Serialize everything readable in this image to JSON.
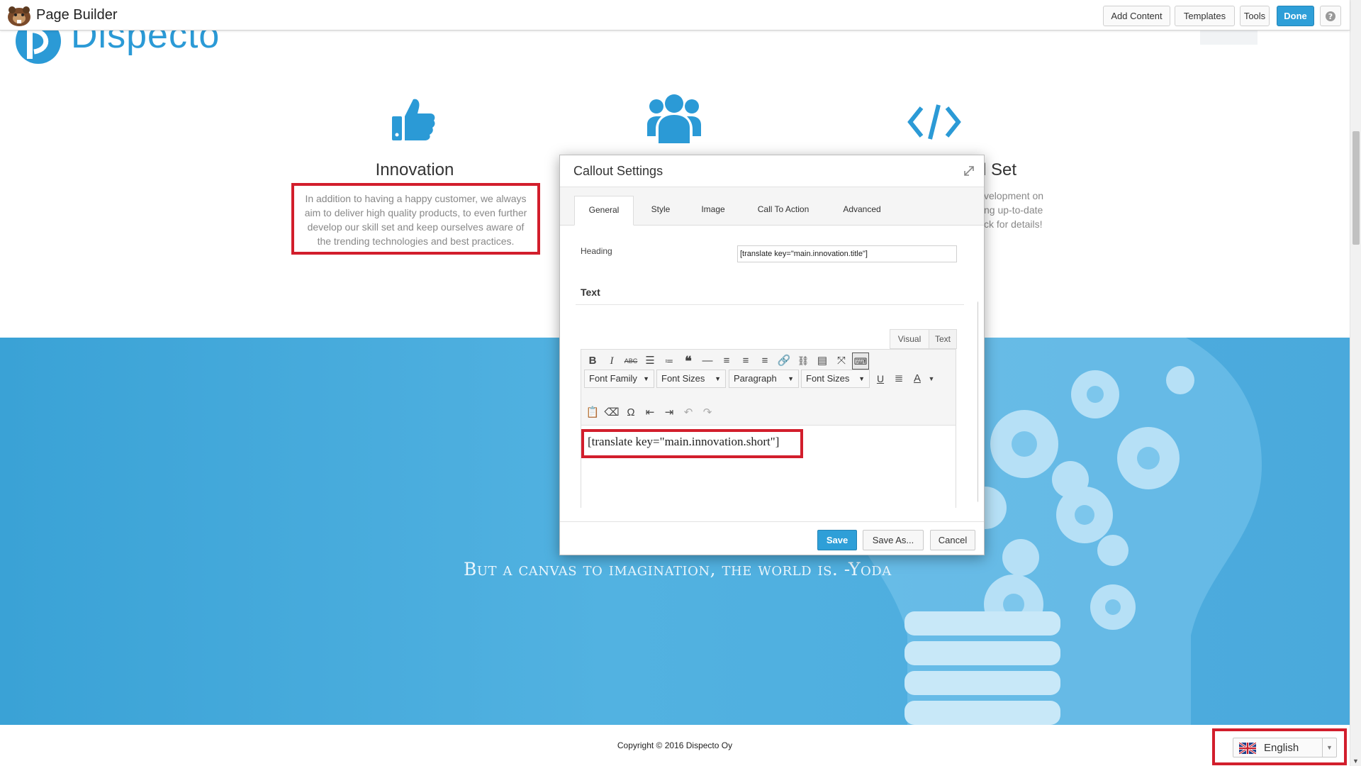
{
  "toolbar": {
    "title": "Page Builder",
    "add_content": "Add Content",
    "templates": "Templates",
    "tools": "Tools",
    "done": "Done",
    "help_icon": "question-icon"
  },
  "site": {
    "logo_text": "Dispecto",
    "features": [
      {
        "icon": "thumbs-up-icon",
        "title": "Innovation",
        "text": "In addition to having a happy customer, we always aim to deliver high quality products, to even further develop our skill set and keep ourselves aware of the trending technologies and best practices."
      },
      {
        "icon": "users-icon",
        "title": "",
        "text": ""
      },
      {
        "icon": "code-icon",
        "title": "l Set",
        "text_lines": [
          "velopment on",
          "ng up-to-date",
          "ck for details!"
        ]
      }
    ],
    "quote": "But a canvas to imagination, the world is. -Yoda",
    "copyright": "Copyright © 2016 Dispecto Oy",
    "language": {
      "selected": "English",
      "flag_icon": "uk-flag-icon"
    }
  },
  "modal": {
    "title": "Callout Settings",
    "tabs": [
      "General",
      "Style",
      "Image",
      "Call To Action",
      "Advanced"
    ],
    "active_tab": "General",
    "heading_label": "Heading",
    "heading_value": "[translate key=\"main.innovation.title\"]",
    "text_section": "Text",
    "editor_tabs": [
      "Visual",
      "Text"
    ],
    "dropdowns": [
      "Font Family",
      "Font Sizes",
      "Paragraph",
      "Font Sizes"
    ],
    "editor_content": "[translate key=\"main.innovation.short\"]",
    "buttons": {
      "save": "Save",
      "save_as": "Save As...",
      "cancel": "Cancel"
    }
  },
  "colors": {
    "accent": "#2e9fd8",
    "highlight": "#d21e2c",
    "band": "#4aaee0"
  }
}
